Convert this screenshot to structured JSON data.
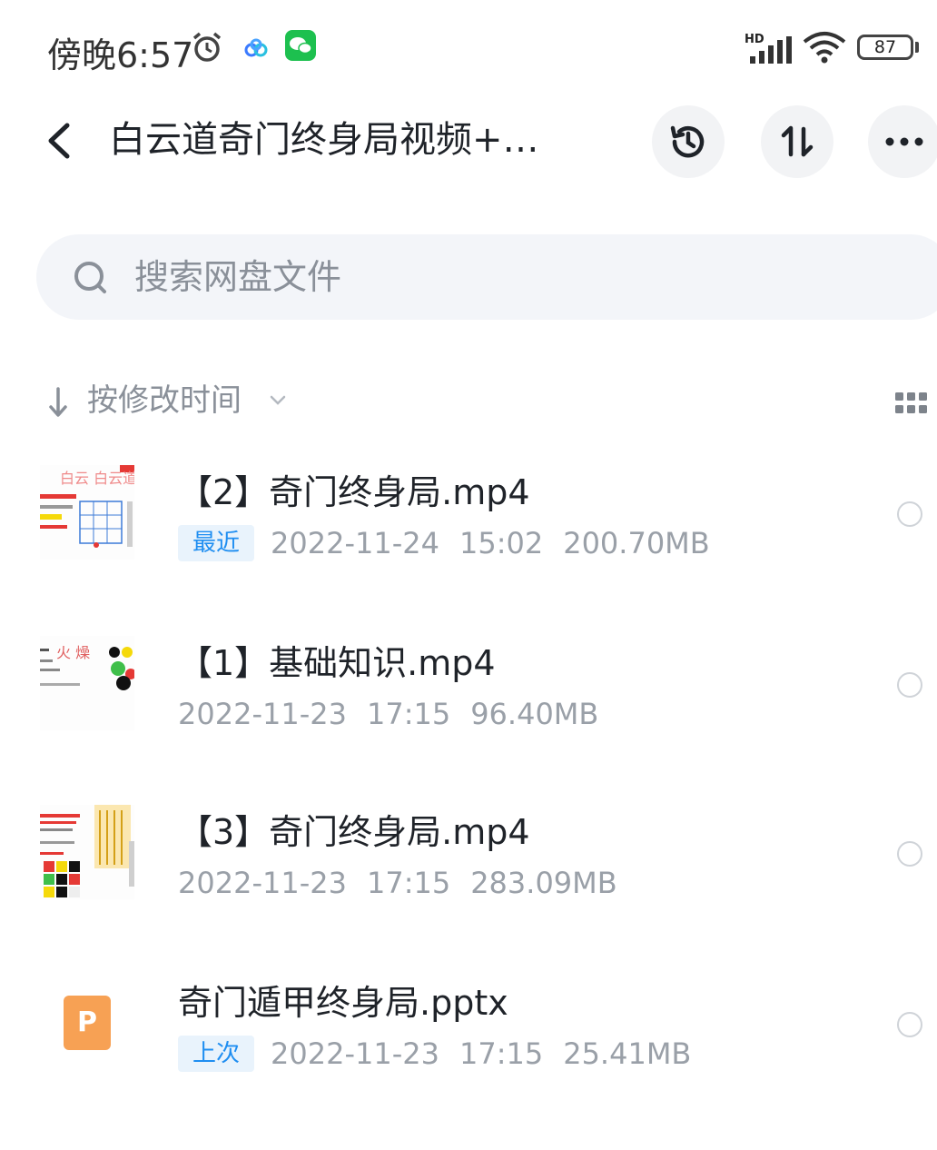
{
  "status_bar": {
    "time": "傍晚6:57",
    "network_label": "HD",
    "battery": "87",
    "icons": [
      "alarm-icon",
      "cloud-icon",
      "wechat-icon",
      "signal-icon",
      "wifi-icon",
      "battery-icon"
    ]
  },
  "header": {
    "title": "白云道奇门终身局视频+…",
    "buttons": [
      "history-icon",
      "sort-icon",
      "more-icon"
    ]
  },
  "search": {
    "placeholder": "搜索网盘文件"
  },
  "sort": {
    "label": "按修改时间"
  },
  "files": [
    {
      "name": "【2】奇门终身局.mp4",
      "tag": "最近",
      "date": "2022-11-24",
      "time": "15:02",
      "size": "200.70MB",
      "thumb_text": "白云  白云道",
      "type": "video"
    },
    {
      "name": "【1】基础知识.mp4",
      "tag": "",
      "date": "2022-11-23",
      "time": "17:15",
      "size": "96.40MB",
      "thumb_text": "火 燥",
      "type": "video"
    },
    {
      "name": "【3】奇门终身局.mp4",
      "tag": "",
      "date": "2022-11-23",
      "time": "17:15",
      "size": "283.09MB",
      "thumb_text": "",
      "type": "video"
    },
    {
      "name": "奇门遁甲终身局.pptx",
      "tag": "上次",
      "date": "2022-11-23",
      "time": "17:15",
      "size": "25.41MB",
      "thumb_text": "P",
      "type": "pptx"
    }
  ],
  "colors": {
    "accent": "#1f8ef1",
    "wechat": "#1dc04f",
    "pptx": "#f7a154",
    "muted": "#9aa0a8"
  }
}
